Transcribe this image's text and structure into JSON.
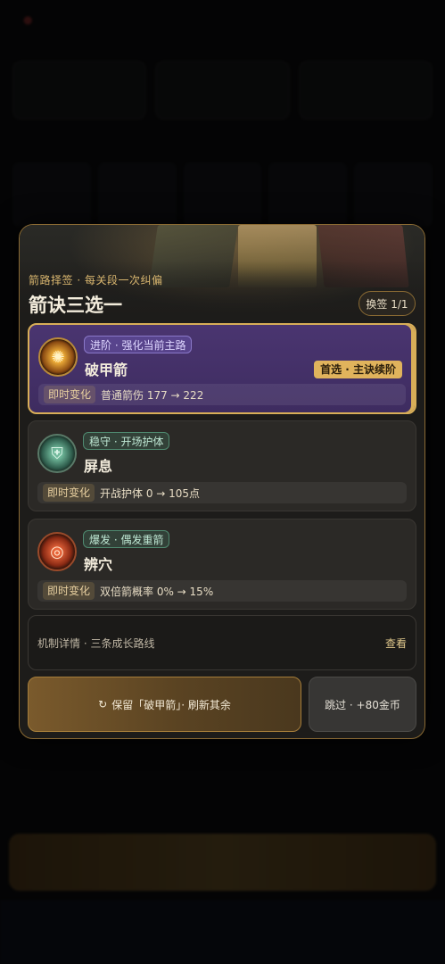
{
  "modal": {
    "subtitle": "箭路择签 · 每关段一次纠偏",
    "title": "箭诀三选一",
    "swap_label": "换签 1/1",
    "options": [
      {
        "tag": "进阶 · 强化当前主路",
        "name": "破甲箭",
        "badge": "首选 · 主诀续阶",
        "effect_label": "即时变化",
        "effect_value": "普通箭伤 177 → 222",
        "icon": "sun-burst-icon",
        "selected": true
      },
      {
        "tag": "稳守 · 开场护体",
        "name": "屏息",
        "effect_label": "即时变化",
        "effect_value": "开战护体 0 → 105点",
        "icon": "shield-icon",
        "selected": false
      },
      {
        "tag": "爆发 · 偶发重箭",
        "name": "辨穴",
        "effect_label": "即时变化",
        "effect_value": "双倍箭概率 0% → 15%",
        "icon": "target-icon",
        "selected": false
      }
    ],
    "detail_label": "机制详情 · 三条成长路线",
    "detail_link": "查看",
    "keep_icon": "↻",
    "keep_label": "保留「破甲箭」· 刷新其余",
    "skip_label": "跳过 · +80金币"
  },
  "colors": {
    "accent_gold": "#d8ae58",
    "selected_bg": "#4a3570",
    "modal_border": "#8a6a33"
  }
}
